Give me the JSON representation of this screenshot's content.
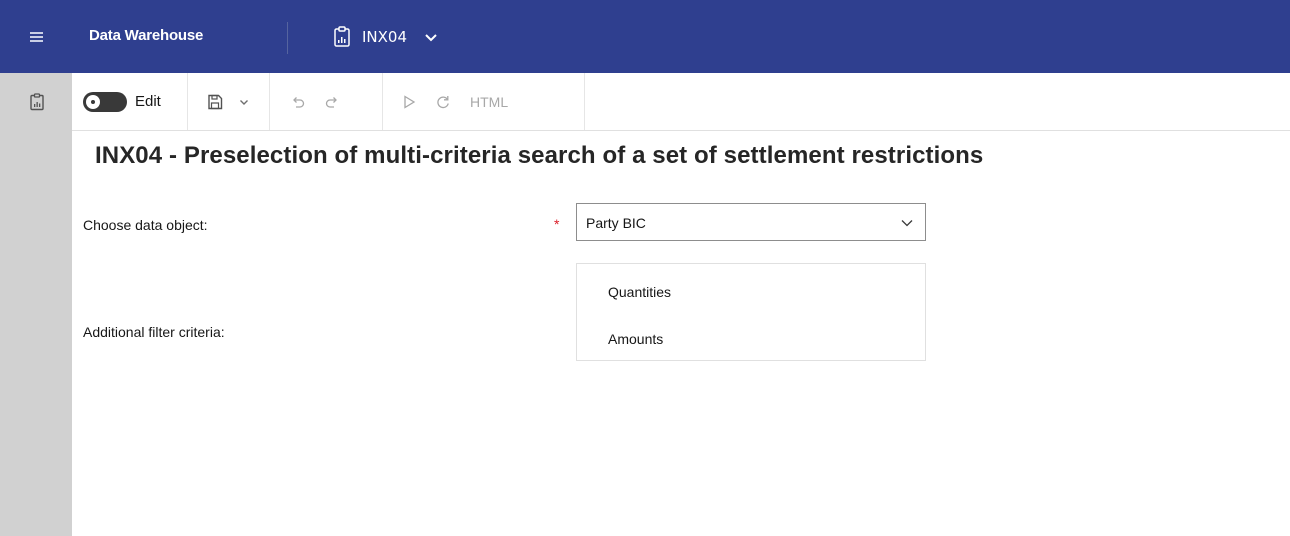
{
  "topbar": {
    "menu_icon": "hamburger-menu-icon",
    "app_title": "Data Warehouse",
    "report_icon": "report-clipboard-icon",
    "report_name": "INX04",
    "report_chevron": "chevron-down-icon",
    "bg_color": "#2f3f8f"
  },
  "leftrail": {
    "icon": "report-clipboard-icon",
    "bg_color": "#d1d1d1"
  },
  "toolbar": {
    "edit_label": "Edit",
    "edit_toggle_icon": "toggle-switch-icon",
    "save_icon": "save-icon",
    "save_menu_icon": "chevron-down-icon",
    "undo_icon": "undo-icon",
    "redo_icon": "redo-icon",
    "run_icon": "play-icon",
    "refresh_icon": "refresh-icon",
    "html_label": "HTML"
  },
  "page": {
    "title": "INX04 - Preselection of multi-criteria search of a set of settlement restrictions"
  },
  "form": {
    "choose_label": "Choose data object:",
    "required_mark": "*",
    "required_color": "#da1e28",
    "selected_value": "Party BIC",
    "additional_label": "Additional filter criteria:",
    "filter_options": [
      "Quantities",
      "Amounts"
    ]
  }
}
